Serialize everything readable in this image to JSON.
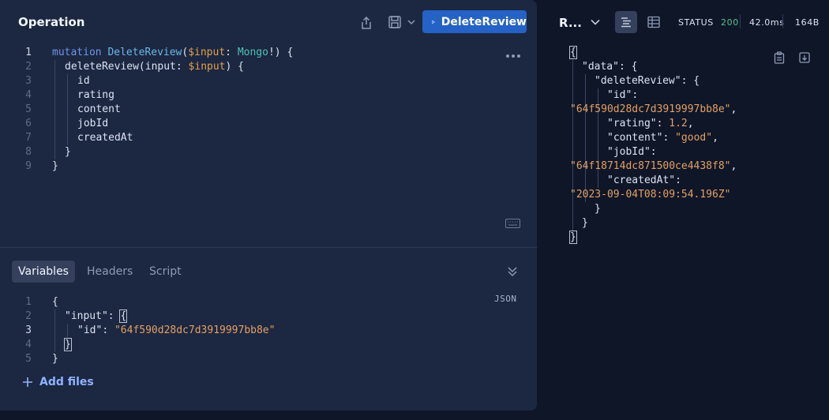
{
  "operation": {
    "title": "Operation",
    "run_label": "DeleteReview",
    "lines": [
      "1",
      "2",
      "3",
      "4",
      "5",
      "6",
      "7",
      "8",
      "9"
    ]
  },
  "query": {
    "mutation": "mutation",
    "op_name": "DeleteReview",
    "var": "$input",
    "colon": ": ",
    "type": "Mongo",
    "bang": "!) {",
    "field": "deleteReview",
    "arg": "input",
    "fields": [
      "id",
      "rating",
      "content",
      "jobId",
      "createdAt"
    ]
  },
  "vars_tabs": [
    "Variables",
    "Headers",
    "Script"
  ],
  "vars": {
    "lang": "JSON",
    "lines": [
      "1",
      "2",
      "3",
      "4",
      "5"
    ],
    "key_input": "\"input\"",
    "key_id": "\"id\"",
    "id_value": "\"64f590d28dc7d3919997bb8e\""
  },
  "add_files": "Add files",
  "response": {
    "title": "R...",
    "status_label": "STATUS",
    "status_code": "200",
    "time": "42.0ms",
    "size": "164B",
    "data_key": "\"data\"",
    "delete_key": "\"deleteReview\"",
    "id_key": "\"id\"",
    "id_value": "\"64f590d28dc7d3919997bb8e\"",
    "rating_key": "\"rating\"",
    "rating_value": "1.2",
    "content_key": "\"content\"",
    "content_value": "\"good\"",
    "jobid_key": "\"jobId\"",
    "jobid_value": "\"64f18714dc871500ce4438f8\"",
    "created_key": "\"createdAt\"",
    "created_value": "\"2023-09-04T08:09:54.196Z\""
  },
  "colors": {
    "accent": "#2462c5",
    "status_ok": "#4fc48a",
    "string": "#e2a163"
  }
}
